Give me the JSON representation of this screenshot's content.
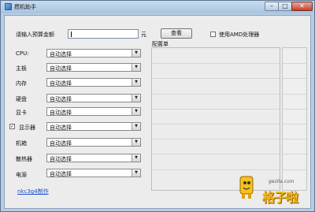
{
  "window": {
    "title": "攒机助手",
    "buttons": {
      "min": "–",
      "max": "□",
      "close": "✕"
    }
  },
  "budget": {
    "label": "请输入预算金额",
    "value": "",
    "unit": "元",
    "query_button": "查看",
    "amd_label": "使用AMD处理器",
    "amd_checked": false
  },
  "components": [
    {
      "label": "CPU:",
      "value": "自动选择"
    },
    {
      "label": "主板",
      "value": "自动选择"
    },
    {
      "label": "内存",
      "value": "自动选择"
    },
    {
      "label": "硬盘",
      "value": "自动选择"
    },
    {
      "label": "显卡",
      "value": "自动选择"
    },
    {
      "label": "显示器",
      "value": "自动选择",
      "checkbox": true,
      "checked": true
    },
    {
      "label": "机箱",
      "value": "自动选择"
    },
    {
      "label": "散热器",
      "value": "自动选择"
    },
    {
      "label": "电源",
      "value": "自动选择"
    }
  ],
  "config": {
    "title": "配置单"
  },
  "footer": {
    "credit": "nkc3g4制作"
  },
  "watermark": {
    "site": "gezila.com",
    "brand": "格子啦"
  },
  "icons": {
    "app": "app-icon",
    "dropdown": "chevron-down-icon",
    "check": "check-icon"
  }
}
